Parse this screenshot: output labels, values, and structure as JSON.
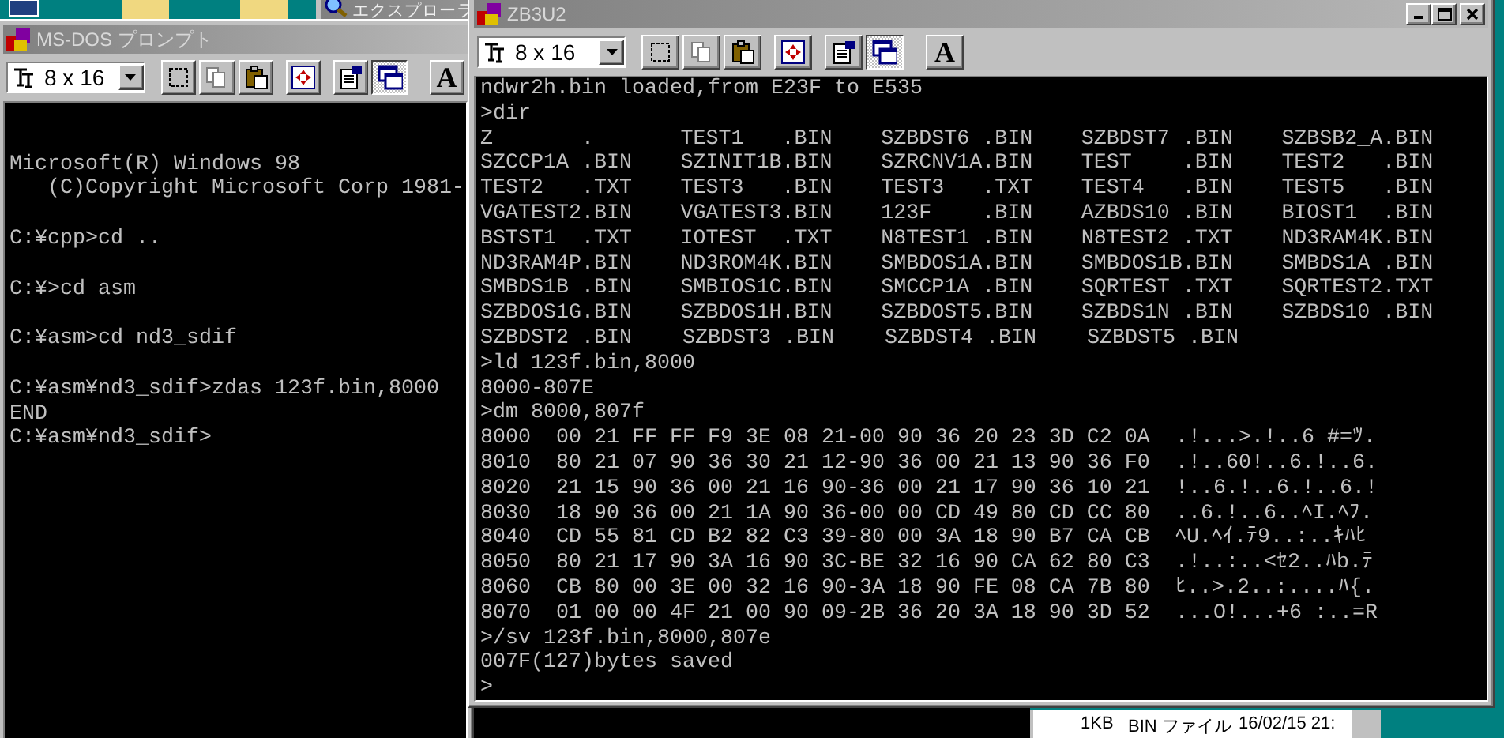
{
  "background_window": {
    "title": "エクスプローラ"
  },
  "windows": [
    {
      "title": "MS-DOS プロンプト",
      "font_size": "8 x 16",
      "window_controls": false,
      "toolbar": [
        {
          "kind": "mark",
          "pressed": false
        },
        {
          "kind": "copy",
          "pressed": false
        },
        {
          "kind": "paste",
          "pressed": false
        },
        {
          "kind": "fullscreen",
          "pressed": false
        },
        {
          "kind": "properties",
          "pressed": false
        },
        {
          "kind": "background",
          "pressed": true
        },
        {
          "kind": "font",
          "pressed": false,
          "label": "A"
        }
      ],
      "console": [
        {
          "kind": "blank"
        },
        {
          "kind": "blank"
        },
        {
          "kind": "text",
          "text": "Microsoft(R) Windows 98"
        },
        {
          "kind": "text",
          "text": "   (C)Copyright Microsoft Corp 1981-"
        },
        {
          "kind": "blank"
        },
        {
          "kind": "text",
          "text": "C:¥cpp>cd .."
        },
        {
          "kind": "blank"
        },
        {
          "kind": "text",
          "text": "C:¥>cd asm"
        },
        {
          "kind": "blank"
        },
        {
          "kind": "text",
          "text": "C:¥asm>cd nd3_sdif"
        },
        {
          "kind": "blank"
        },
        {
          "kind": "text",
          "text": "C:¥asm¥nd3_sdif>zdas 123f.bin,8000"
        },
        {
          "kind": "text",
          "text": "END"
        },
        {
          "kind": "text",
          "text": "C:¥asm¥nd3_sdif>"
        }
      ]
    },
    {
      "title": "ZB3U2",
      "font_size": "8 x 16",
      "window_controls": true,
      "toolbar": [
        {
          "kind": "mark",
          "pressed": false
        },
        {
          "kind": "copy",
          "pressed": false
        },
        {
          "kind": "paste",
          "pressed": false
        },
        {
          "kind": "fullscreen",
          "pressed": false
        },
        {
          "kind": "properties",
          "pressed": false
        },
        {
          "kind": "background",
          "pressed": true
        },
        {
          "kind": "font",
          "pressed": false,
          "label": "A"
        }
      ],
      "console": [
        {
          "kind": "text",
          "text": "ndwr2h.bin loaded,from E23F to E535"
        },
        {
          "kind": "text",
          "text": ">dir"
        },
        {
          "kind": "dir",
          "entries": [
            "Z       .",
            "TEST1   .BIN",
            "SZBDST6 .BIN",
            "SZBDST7 .BIN",
            "SZBSB2_A.BIN"
          ]
        },
        {
          "kind": "dir",
          "entries": [
            "SZCCP1A .BIN",
            "SZINIT1B.BIN",
            "SZRCNV1A.BIN",
            "TEST    .BIN",
            "TEST2   .BIN"
          ]
        },
        {
          "kind": "dir",
          "entries": [
            "TEST2   .TXT",
            "TEST3   .BIN",
            "TEST3   .TXT",
            "TEST4   .BIN",
            "TEST5   .BIN"
          ]
        },
        {
          "kind": "dir",
          "entries": [
            "VGATEST2.BIN",
            "VGATEST3.BIN",
            "123F    .BIN",
            "AZBDS10 .BIN",
            "BIOST1  .BIN"
          ]
        },
        {
          "kind": "dir",
          "entries": [
            "BSTST1  .TXT",
            "IOTEST  .TXT",
            "N8TEST1 .BIN",
            "N8TEST2 .TXT",
            "ND3RAM4K.BIN"
          ]
        },
        {
          "kind": "dir",
          "entries": [
            "ND3RAM4P.BIN",
            "ND3ROM4K.BIN",
            "SMBDOS1A.BIN",
            "SMBDOS1B.BIN",
            "SMBDS1A .BIN"
          ]
        },
        {
          "kind": "dir",
          "entries": [
            "SMBDS1B .BIN",
            "SMBIOS1C.BIN",
            "SMCCP1A .BIN",
            "SQRTEST .TXT",
            "SQRTEST2.TXT"
          ]
        },
        {
          "kind": "dir",
          "entries": [
            "SZBDOS1G.BIN",
            "SZBDOS1H.BIN",
            "SZBDOST5.BIN",
            "SZBDS1N .BIN",
            "SZBDS10 .BIN"
          ]
        },
        {
          "kind": "dir",
          "entries": [
            "SZBDST2 .BIN",
            "SZBDST3 .BIN",
            "SZBDST4 .BIN",
            "SZBDST5 .BIN"
          ]
        },
        {
          "kind": "text",
          "text": ">ld 123f.bin,8000"
        },
        {
          "kind": "text",
          "text": "8000-807E"
        },
        {
          "kind": "text",
          "text": ">dm 8000,807f"
        },
        {
          "kind": "hex",
          "address": "8000",
          "bytes": "00 21 FF FF F9 3E 08 21-00 90 36 20 23 3D C2 0A",
          "ascii": ".!...>.!..6 #=ﾂ."
        },
        {
          "kind": "hex",
          "address": "8010",
          "bytes": "80 21 07 90 36 30 21 12-90 36 00 21 13 90 36 F0",
          "ascii": ".!..60!..6.!..6."
        },
        {
          "kind": "hex",
          "address": "8020",
          "bytes": "21 15 90 36 00 21 16 90-36 00 21 17 90 36 10 21",
          "ascii": "!..6.!..6.!..6.!"
        },
        {
          "kind": "hex",
          "address": "8030",
          "bytes": "18 90 36 00 21 1A 90 36-00 00 CD 49 80 CD CC 80",
          "ascii": "..6.!..6..ﾍI.ﾍﾌ."
        },
        {
          "kind": "hex",
          "address": "8040",
          "bytes": "CD 55 81 CD B2 82 C3 39-80 00 3A 18 90 B7 CA CB",
          "ascii": "ﾍU.ﾍｲ.ﾃ9..:..ｷﾊﾋ"
        },
        {
          "kind": "hex",
          "address": "8050",
          "bytes": "80 21 17 90 3A 16 90 3C-BE 32 16 90 CA 62 80 C3",
          "ascii": ".!..:..<ｾ2..ﾊb.ﾃ"
        },
        {
          "kind": "hex",
          "address": "8060",
          "bytes": "CB 80 00 3E 00 32 16 90-3A 18 90 FE 08 CA 7B 80",
          "ascii": "ﾋ..>.2..:....ﾊ{."
        },
        {
          "kind": "hex",
          "address": "8070",
          "bytes": "01 00 00 4F 21 00 90 09-2B 36 20 3A 18 90 3D 52",
          "ascii": "...O!...+6 :..=R"
        },
        {
          "kind": "text",
          "text": ">/sv 123f.bin,8000,807e"
        },
        {
          "kind": "text",
          "text": "007F(127)bytes saved"
        },
        {
          "kind": "text",
          "text": ">"
        }
      ]
    }
  ],
  "explorer_row": {
    "size": "1KB",
    "type": "BIN ファイル",
    "date": "16/02/15 21:"
  }
}
